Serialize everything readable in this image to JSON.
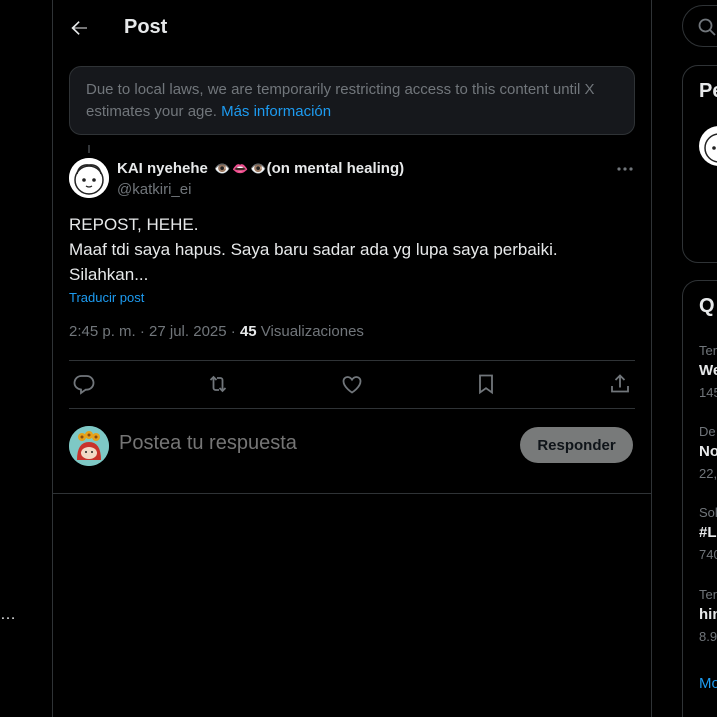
{
  "left": {
    "more_label": "…"
  },
  "header": {
    "title": "Post"
  },
  "notice": {
    "text": "Due to local laws, we are temporarily restricting access to this content until X estimates your age.",
    "link": "Más información"
  },
  "post": {
    "display_name": "KAI nyehehe",
    "name_emojis": [
      "👁️",
      "👄",
      "👁️"
    ],
    "name_suffix": "(on mental healing)",
    "handle": "@katkiri_ei",
    "lines": [
      "REPOST, HEHE.",
      "Maaf tdi saya hapus. Saya baru sadar ada yg lupa saya perbaiki.",
      "Silahkan..."
    ],
    "translate_label": "Traducir post",
    "time": "2:45 p. m. · 27 jul. 2025 ·",
    "views_count": "45",
    "views_label": "Visualizaciones"
  },
  "reply": {
    "placeholder": "Postea tu respuesta",
    "button": "Responder"
  },
  "sidebar": {
    "card1_title": "Pe",
    "card2_title": "Q",
    "trends": [
      {
        "category": "Ten",
        "name": "We",
        "count": "145"
      },
      {
        "category": "De",
        "name": "No",
        "count": "22,"
      },
      {
        "category": "Sol",
        "name": "#L",
        "count": "740"
      },
      {
        "category": "Ten",
        "name": "hin",
        "count": "8.9"
      }
    ],
    "show_more": "Mo"
  },
  "colors": {
    "accent": "#1d9bf0",
    "background": "#000000",
    "border": "#2f3336",
    "muted": "#71767b"
  }
}
